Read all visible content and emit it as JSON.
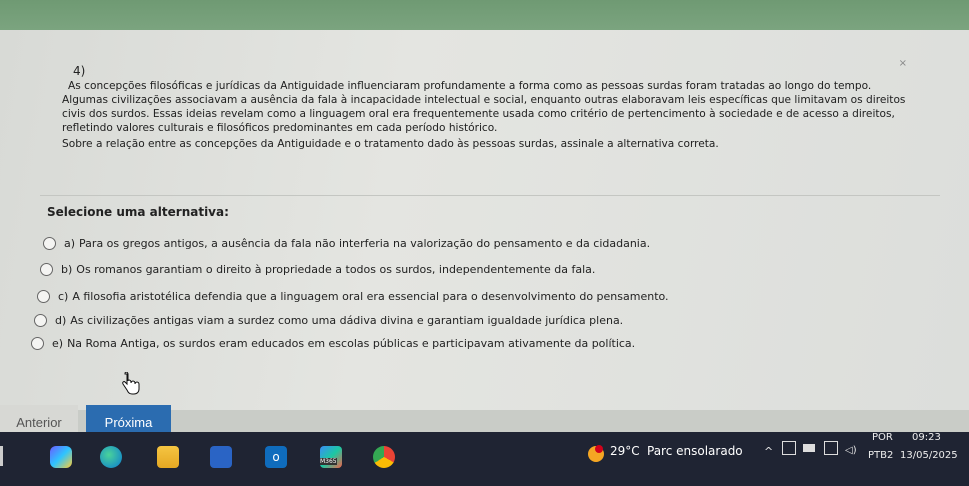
{
  "question": {
    "number": "4)",
    "close_glyph": "×",
    "statement_lines": [
      "As concepções filosóficas e jurídicas da Antiguidade influenciaram profundamente a forma como as pessoas surdas foram tratadas ao longo do tempo.",
      "Algumas civilizações associavam a ausência da fala à incapacidade intelectual e social, enquanto outras elaboravam leis específicas que limitavam os direitos",
      "civis dos surdos. Essas ideias revelam como a linguagem oral era frequentemente usada como critério de pertencimento à sociedade e de acesso a direitos,",
      "refletindo valores culturais e filosóficos predominantes em cada período histórico.",
      "Sobre a relação entre as concepções da Antiguidade e o tratamento dado às pessoas surdas, assinale a alternativa correta."
    ]
  },
  "select_label": "Selecione uma alternativa:",
  "options": [
    {
      "letter": "a)",
      "text": "Para os gregos antigos, a ausência da fala não interferia na valorização do pensamento e da cidadania."
    },
    {
      "letter": "b)",
      "text": "Os romanos garantiam o direito à propriedade a todos os surdos, independentemente da fala."
    },
    {
      "letter": "c)",
      "text": "A filosofia aristotélica defendia que a linguagem oral era essencial para o desenvolvimento do pensamento."
    },
    {
      "letter": "d)",
      "text": "As civilizações antigas viam a surdez como uma dádiva divina e garantiam igualdade jurídica plena."
    },
    {
      "letter": "e)",
      "text": "Na Roma Antiga, os surdos eram educados em escolas públicas e participavam ativamente da política."
    }
  ],
  "nav": {
    "prev_label": "Anterior",
    "next_label": "Próxima"
  },
  "taskbar": {
    "weather_temp": "29°C",
    "weather_desc": "Parc ensolarado",
    "lang_top": "POR",
    "lang_bottom": "PTB2",
    "time": "09:23",
    "date": "13/05/2025",
    "icons": [
      "copilot-icon",
      "edge-icon",
      "explorer-icon",
      "store-icon",
      "outlook-icon",
      "m365-icon",
      "chrome-icon"
    ],
    "m365_label": "M365"
  },
  "colors": {
    "accent_green": "#77a27a",
    "next_button": "#2b6cb0",
    "taskbar": "#1f2433"
  }
}
